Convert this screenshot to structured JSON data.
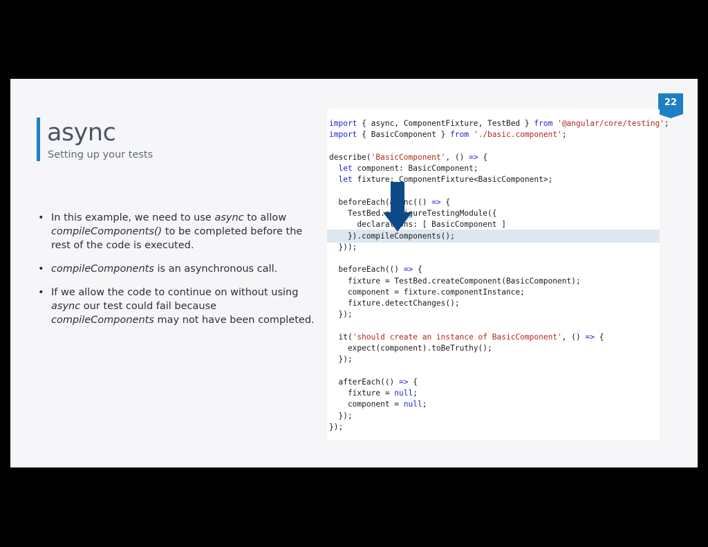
{
  "slide": {
    "title": "async",
    "subtitle": "Setting up your tests",
    "page_number": "22",
    "colors": {
      "accent": "#1f7fc4",
      "badge": "#1f7fc4",
      "arrow": "#0d4a86",
      "highlight": "#dde7ef"
    }
  },
  "bullets": [
    {
      "parts": [
        "In this example, we need to use ",
        "async",
        " to allow ",
        "compileComponents()",
        " to be completed before the rest of the code is executed."
      ]
    },
    {
      "parts": [
        "compileComponents",
        " is an asynchronous call."
      ]
    },
    {
      "parts": [
        "If we allow the code to continue on without using ",
        "async",
        " our test could fail because ",
        "compileComponents",
        " may not have been completed."
      ]
    }
  ],
  "code": {
    "lines": [
      "import { async, ComponentFixture, TestBed } from '@angular/core/testing';",
      "import { BasicComponent } from './basic.component';",
      "",
      "describe('BasicComponent', () => {",
      "  let component: BasicComponent;",
      "  let fixture: ComponentFixture<BasicComponent>;",
      "",
      "  beforeEach(async(() => {",
      "    TestBed.configureTestingModule({",
      "      declarations: [ BasicComponent ]",
      "    }).compileComponents();",
      "  }));",
      "",
      "  beforeEach(() => {",
      "    fixture = TestBed.createComponent(BasicComponent);",
      "    component = fixture.componentInstance;",
      "    fixture.detectChanges();",
      "  });",
      "",
      "  it('should create an instance of BasicComponent', () => {",
      "    expect(component).toBeTruthy();",
      "  });",
      "",
      "  afterEach(() => {",
      "    fixture = null;",
      "    component = null;",
      "  });",
      "});"
    ],
    "highlighted_line": 10
  }
}
